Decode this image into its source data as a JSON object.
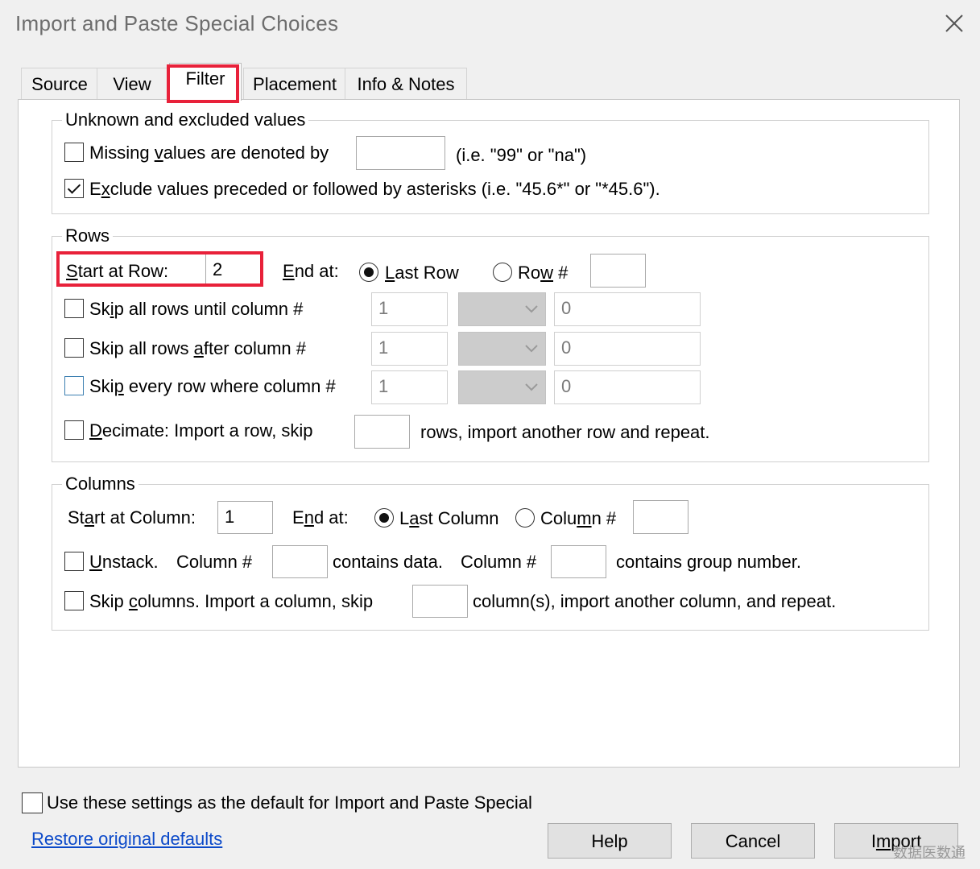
{
  "window": {
    "title": "Import and Paste Special Choices"
  },
  "icons": {
    "close": "close-icon",
    "dropdown": "chevron-down-icon"
  },
  "colors": {
    "highlight": "#e8213a",
    "link": "#0b49c9"
  },
  "tabs": [
    {
      "label": "Source"
    },
    {
      "label": "View"
    },
    {
      "label": "Filter"
    },
    {
      "label": "Placement"
    },
    {
      "label": "Info & Notes"
    }
  ],
  "unknown": {
    "legend": "Unknown and excluded values",
    "missing_pre": "Missing ",
    "missing_u": "v",
    "missing_post": "alues are denoted by",
    "missing_value": "",
    "missing_hint": "(i.e. \"99\" or \"na\")",
    "exclude_pre": "E",
    "exclude_u": "x",
    "exclude_post": "clude values preceded or followed by asterisks (i.e. \"45.6*\" or \"*45.6\").",
    "missing_checked": false,
    "exclude_checked": true
  },
  "rows": {
    "legend": "Rows",
    "start_u": "S",
    "start_post": "tart at Row:",
    "start_value": "2",
    "end_u": "E",
    "end_post": "nd at:",
    "last_row_u": "L",
    "last_row_post": "ast Row",
    "row_pre": "Ro",
    "row_u": "w",
    "row_post": " #",
    "row_value": "",
    "skip_until_pre": "Sk",
    "skip_until_u": "i",
    "skip_until_post": "p all rows until column #",
    "skip_after_pre": "Skip all rows ",
    "skip_after_u": "a",
    "skip_after_post": "fter column #",
    "skip_every_pre": "Ski",
    "skip_every_u": "p",
    "skip_every_post": " every row where column #",
    "col_default": "1",
    "val_default": "0",
    "decimate_u": "D",
    "decimate_post": "ecimate: Import a row, skip",
    "decimate_value": "",
    "decimate_tail": "rows, import another row and repeat."
  },
  "columns": {
    "legend": "Columns",
    "start_pre": "St",
    "start_u": "a",
    "start_post": "rt at Column:",
    "start_value": "1",
    "end_pre": "E",
    "end_u": "n",
    "end_post": "d at:",
    "last_pre": "L",
    "last_u": "a",
    "last_post": "st Column",
    "col_pre": "Colu",
    "col_u": "m",
    "col_post": "n #",
    "col_value": "",
    "unstack_u": "U",
    "unstack_post": "nstack.",
    "unstack_col": "Column #",
    "unstack_data": "contains data.",
    "unstack_col2": "Column #",
    "unstack_group": "contains group  number.",
    "skipcols_pre": "Skip ",
    "skipcols_u": "c",
    "skipcols_post": "olumns. Import a column, skip",
    "skipcols_tail": "column(s), import another column, and repeat."
  },
  "footer": {
    "default_label": "Use these settings as the default for Import and Paste Special",
    "restore_pre": "Restore ori",
    "restore_u": "g",
    "restore_post": "inal defaults",
    "help": "Help",
    "cancel": "Cancel",
    "import_pre": "I",
    "import_u": "m",
    "import_post": "port"
  },
  "watermark": "数据医数通"
}
